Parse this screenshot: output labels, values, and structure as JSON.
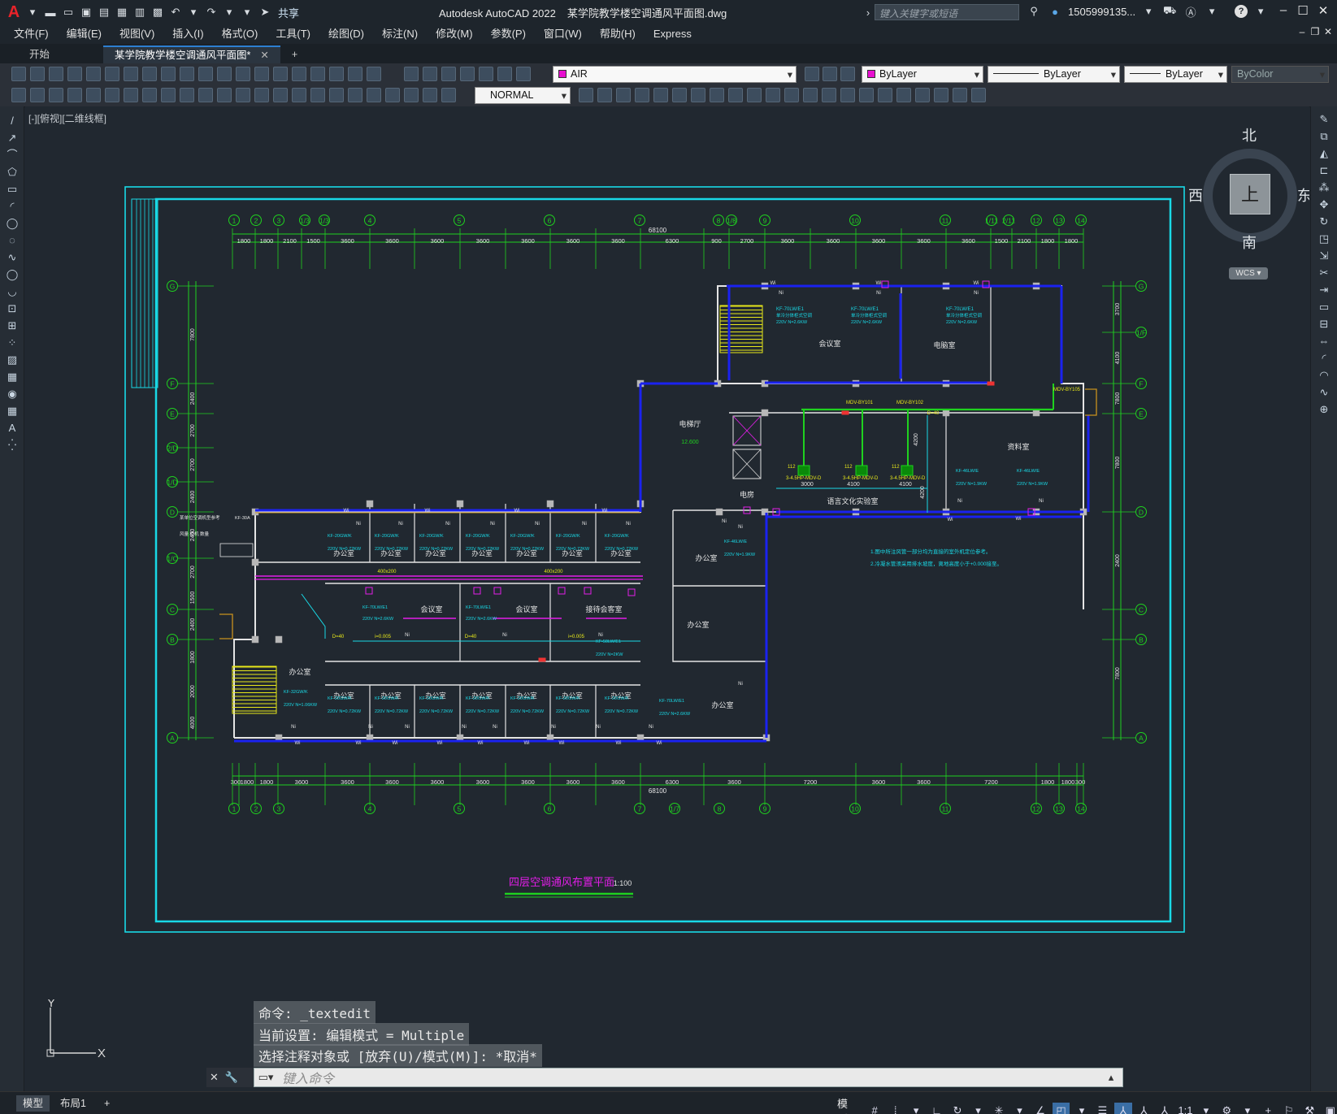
{
  "titlebar": {
    "logo": "A",
    "share": "共享",
    "app_name": "Autodesk AutoCAD 2022",
    "file_name": "某学院教学楼空调通风平面图.dwg",
    "search_placeholder": "键入关键字或短语",
    "user": "1505999135...",
    "help": "?"
  },
  "menus": [
    "文件(F)",
    "编辑(E)",
    "视图(V)",
    "插入(I)",
    "格式(O)",
    "工具(T)",
    "绘图(D)",
    "标注(N)",
    "修改(M)",
    "参数(P)",
    "窗口(W)",
    "帮助(H)",
    "Express"
  ],
  "tabs": {
    "start": "开始",
    "doc": "某学院教学楼空调通风平面图*",
    "add": "+"
  },
  "toolbar": {
    "layer": "AIR",
    "layer_color": "#e80fd0",
    "color": "ByLayer",
    "color_swatch": "#e80fd0",
    "linetype": "ByLayer",
    "lineweight": "ByLayer",
    "plotstyle": "ByColor",
    "dimstyle": "NORMAL"
  },
  "viewport": {
    "label": "[-][俯视][二维线框]"
  },
  "compass": {
    "north": "北",
    "south": "南",
    "east": "东",
    "west": "西",
    "top": "上",
    "wcs": "WCS"
  },
  "drawing": {
    "title": "四层空调通风布置平面",
    "scale": "1:100",
    "total_dim": "68100",
    "top_dims": [
      "1800",
      "1800",
      "2100",
      "1500",
      "3600",
      "3600",
      "3600",
      "3600",
      "3600",
      "3600",
      "3600",
      "6300",
      "900",
      "2700",
      "3600",
      "3600",
      "3600",
      "3600",
      "3600",
      "1500",
      "2100",
      "1800",
      "1800"
    ],
    "bottom_dims": [
      "300",
      "1800",
      "1800",
      "3600",
      "3600",
      "3600",
      "3600",
      "3600",
      "3600",
      "3600",
      "3600",
      "6300",
      "3600",
      "7200",
      "3600",
      "3600",
      "7200",
      "1800",
      "1800",
      "300"
    ],
    "top_axes": [
      "1",
      "2",
      "3",
      "1/3",
      "1/3",
      "4",
      "5",
      "6",
      "7",
      "8",
      "1/8",
      "9",
      "10",
      "11",
      "1/11",
      "2/11",
      "12",
      "13",
      "14"
    ],
    "bottom_axes": [
      "1",
      "2",
      "3",
      "4",
      "5",
      "6",
      "7",
      "1/7",
      "8",
      "9",
      "10",
      "11",
      "12",
      "13",
      "14"
    ],
    "left_axes": [
      "G",
      "F",
      "E",
      "2/D",
      "1/D",
      "D",
      "1/C",
      "C",
      "B",
      "A"
    ],
    "right_axes": [
      "G",
      "1/F",
      "F",
      "E",
      "D",
      "C",
      "B",
      "A"
    ],
    "left_dims": [
      "7800",
      "2400",
      "2700",
      "2700",
      "2400",
      "2400",
      "2700",
      "1500",
      "2400",
      "1800",
      "2000",
      "4000"
    ],
    "right_dims": [
      "3700",
      "4100",
      "7800",
      "7800",
      "2400",
      "7800"
    ],
    "rooms": {
      "meeting1": "会议室",
      "computer": "电脑室",
      "elevator_hall": "电梯厅",
      "elevation": "12.600",
      "electric": "电房",
      "reading": "资料室",
      "language": "语言文化实验室",
      "office": "办公室",
      "meeting2": "会议室",
      "meeting3": "会议室",
      "reception": "接待会客室"
    },
    "units": {
      "kf70": "KF-70LW/E1",
      "kf70_desc": "单冷分体柜式空调",
      "kf70_pow": "220V N=2.6KW",
      "kf20": "KF-20GW/K",
      "kf20_pow": "220V N=0.72KW",
      "kf46": "KF-46LW/E",
      "kf46_pow": "220V N=1.9KW",
      "kf50": "KF-50LW/E1",
      "kf50_pow": "220V N=2KW",
      "kf32": "KF-32GW/K",
      "kf32_pow": "220V N=1.06KW",
      "mdv1": "MDV-BY101",
      "mdv2": "MDV-BY102",
      "mdv5": "MDV-BY105",
      "mdv_unit": "3-4.5HP-MDV-D",
      "n112": "112",
      "duct": "400x200",
      "pipe": "D=40",
      "slope": "i=0.005",
      "ni": "Ni",
      "wi": "Wi"
    },
    "dims_inner": {
      "d3000": "3000",
      "d4100a": "4100",
      "d4100b": "4100",
      "d4200a": "4200",
      "d4200b": "4200"
    },
    "notes": [
      "1.图中所注风管一部分均为直接的室外机定位参考。",
      "2.冷凝水管须采用排水坡度，离地高度小于+0.000接至。"
    ],
    "left_note": {
      "a": "某单位空调机型参考",
      "b": "KF-30A",
      "c": "风量  柜机  数量"
    }
  },
  "command": {
    "h1": "命令: _textedit",
    "h2": "当前设置: 编辑模式 = Multiple",
    "h3": "选择注释对象或 [放弃(U)/模式(M)]: *取消*",
    "placeholder": "键入命令"
  },
  "ucs": {
    "y": "Y",
    "x": "X"
  },
  "status": {
    "model_tab": "模型",
    "layout_tab": "布局1",
    "add": "+",
    "model": "模型",
    "scale": "1:1"
  }
}
